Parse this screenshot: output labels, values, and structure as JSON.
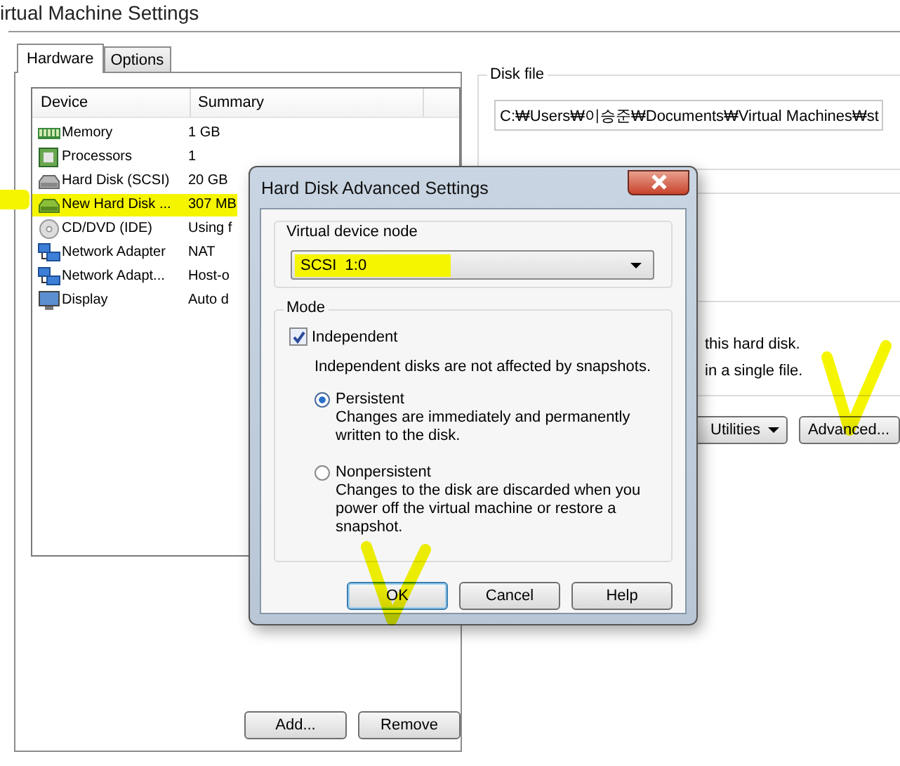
{
  "window": {
    "title": "irtual Machine Settings"
  },
  "tabs": [
    {
      "label": "Hardware",
      "selected": true
    },
    {
      "label": "Options",
      "selected": false
    }
  ],
  "device_table": {
    "columns": [
      "Device",
      "Summary"
    ],
    "rows": [
      {
        "kind": "memory",
        "device": "Memory",
        "summary": "1 GB",
        "highlighted": false
      },
      {
        "kind": "processor",
        "device": "Processors",
        "summary": "1",
        "highlighted": false
      },
      {
        "kind": "disk",
        "device": "Hard Disk (SCSI)",
        "summary": "20 GB",
        "highlighted": false
      },
      {
        "kind": "new-disk",
        "device": "New Hard Disk ...",
        "summary": "307 MB",
        "highlighted": true
      },
      {
        "kind": "cd",
        "device": "CD/DVD (IDE)",
        "summary": "Using f",
        "highlighted": false
      },
      {
        "kind": "network",
        "device": "Network Adapter",
        "summary": "NAT",
        "highlighted": false
      },
      {
        "kind": "network",
        "device": "Network Adapt...",
        "summary": "Host-o",
        "highlighted": false
      },
      {
        "kind": "display",
        "device": "Display",
        "summary": "Auto d",
        "highlighted": false
      }
    ]
  },
  "device_buttons": [
    "Add...",
    "Remove"
  ],
  "disk_file": {
    "label": "Disk file",
    "value": "C:₩Users₩이승준₩Documents₩Virtual Machines₩st"
  },
  "disk_notes": [
    "this hard disk.",
    "in a single file."
  ],
  "disk_buttons": [
    {
      "kind": "menu",
      "label": "Utilities"
    },
    {
      "kind": "plain",
      "label": "Advanced..."
    }
  ],
  "dialog": {
    "title": "Hard Disk Advanced Settings",
    "device_node": {
      "label": "Virtual device node",
      "value": "SCSI  1:0",
      "highlighted": true
    },
    "mode": {
      "label": "Mode",
      "independent": {
        "label": "Independent",
        "checked": true
      },
      "note": "Independent disks are not affected by snapshots.",
      "options": [
        {
          "label": "Persistent",
          "description": "Changes are immediately and permanently written to the disk.",
          "selected": true
        },
        {
          "label": "Nonpersistent",
          "description": "Changes to the disk are discarded when you power off the virtual machine or restore a snapshot.",
          "selected": false
        }
      ]
    },
    "buttons": [
      {
        "label": "OK",
        "default": true
      },
      {
        "label": "Cancel",
        "default": false
      },
      {
        "label": "Help",
        "default": false
      }
    ]
  }
}
